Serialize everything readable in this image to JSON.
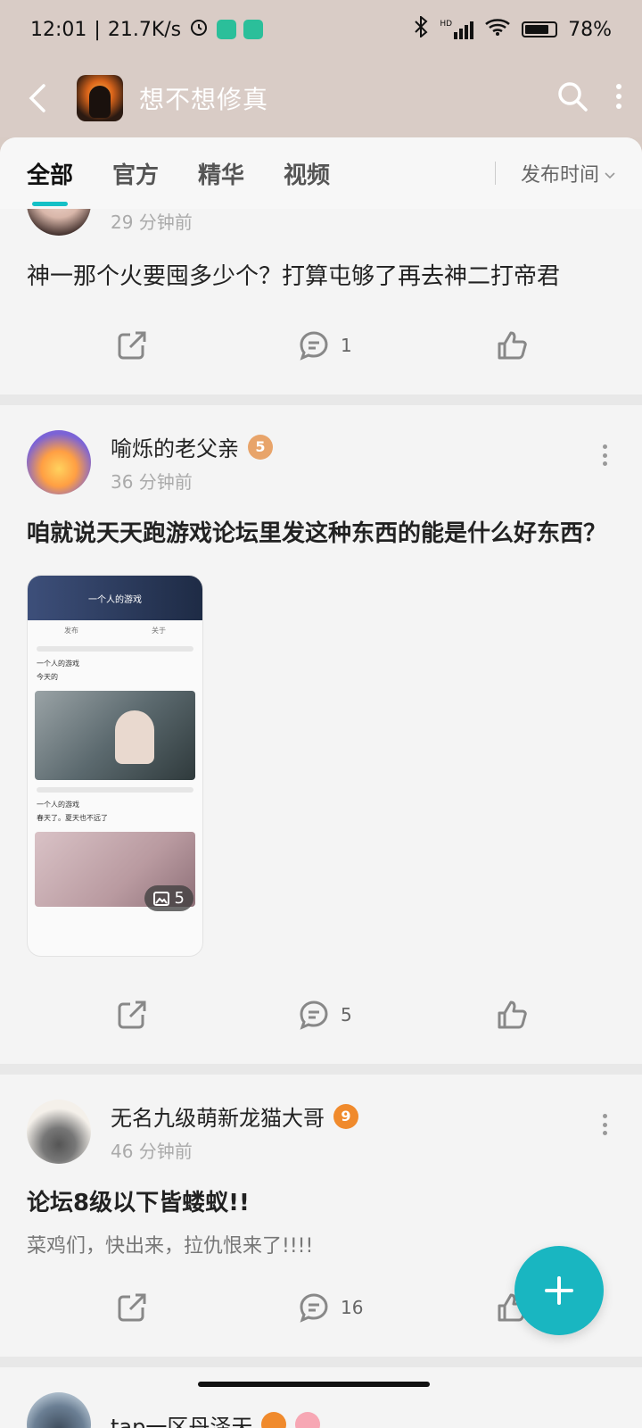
{
  "status": {
    "time": "12:01",
    "speed": "21.7K/s",
    "network": "HD",
    "wifi_label": "6",
    "battery": "78%"
  },
  "header": {
    "title": "想不想修真"
  },
  "tabs": [
    {
      "label": "全部"
    },
    {
      "label": "官方"
    },
    {
      "label": "精华"
    },
    {
      "label": "视频"
    }
  ],
  "sort_label": "发布时间",
  "posts": [
    {
      "time": "29 分钟前",
      "title": "神一那个火要囤多少个？打算屯够了再去神二打帝君",
      "comments": "1"
    },
    {
      "author": "喻烁的老父亲",
      "level": "5",
      "time": "36 分钟前",
      "title": "咱就说天天跑游戏论坛里发这种东西的能是什么好东西？",
      "comments": "5",
      "image_count": "5",
      "thumb": {
        "header": "一个人的游戏",
        "tab_publish": "发布",
        "tab_about": "关于",
        "post1_author": "一个人的游戏",
        "post1_text": "今天的",
        "post2_author": "一个人的游戏",
        "post2_text": "春天了。夏天也不远了"
      }
    },
    {
      "author": "无名九级萌新龙猫大哥",
      "level": "9",
      "time": "46 分钟前",
      "title": "论坛8级以下皆蝼蚁!!",
      "body": "菜鸡们，快出来，拉仇恨来了!!!!",
      "comments": "16"
    },
    {
      "author": "tap一区丹泽天"
    }
  ]
}
